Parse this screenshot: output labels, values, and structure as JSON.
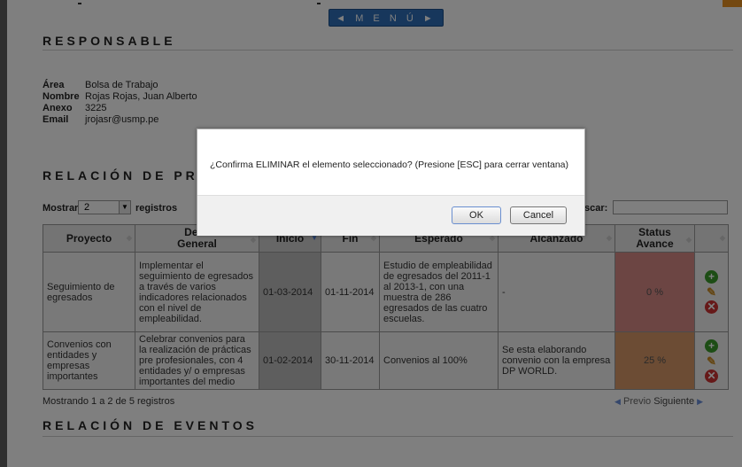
{
  "menu": {
    "label": "◄ M E N Ú ►"
  },
  "responsable": {
    "title": "RESPONSABLE",
    "fields": [
      {
        "label": "Área",
        "value": "Bolsa de Trabajo"
      },
      {
        "label": "Nombre",
        "value": "Rojas Rojas, Juan Alberto"
      },
      {
        "label": "Anexo",
        "value": "3225"
      },
      {
        "label": "Email",
        "value": "jrojasr@usmp.pe"
      }
    ]
  },
  "relacion": {
    "title": "RELACIÓN DE PR",
    "show_label": "Mostrar",
    "show_value": "2",
    "records_label": "registros",
    "search_label": "scar:",
    "search_value": ""
  },
  "table": {
    "headers": [
      "Proyecto",
      "Desc\nGeneral",
      "Inicio",
      "Fin",
      "Esperado",
      "Alcanzado",
      "Status\nAvance",
      ""
    ],
    "rows": [
      {
        "proyecto": "Seguimiento de egresados",
        "descripcion": "Implementar el seguimiento de egresados a través de varios indicadores relacionados con el nivel de empleabilidad.",
        "inicio": "01-03-2014",
        "fin": "01-11-2014",
        "esperado": "Estudio de empleabilidad de egresados del 2011-1 al 2013-1, con una muestra de 286 egresados de las cuatro escuelas.",
        "alcanzado": "-",
        "avance": "0 %"
      },
      {
        "proyecto": "Convenios con entidades y empresas importantes",
        "descripcion": "Celebrar convenios para la realización de prácticas pre profesionales, con 4 entidades y/ o empresas importantes del medio",
        "inicio": "01-02-2014",
        "fin": "30-11-2014",
        "esperado": "Convenios al 100%",
        "alcanzado": "Se esta elaborando convenio con la empresa DP WORLD.",
        "avance": "25 %"
      }
    ],
    "footer": "Mostrando 1 a 2 de 5 registros",
    "prev": "Previo",
    "next": "Siguiente"
  },
  "eventos": {
    "title": "RELACIÓN DE EVENTOS"
  },
  "dialog": {
    "message": "¿Confirma ELIMINAR el elemento seleccionado? (Presione [ESC] para cerrar ventana)",
    "ok": "OK",
    "cancel": "Cancel"
  },
  "colors": {
    "menu": "#2e6fb8",
    "status_zero": "#d88a86",
    "status_partial": "#d89868"
  }
}
